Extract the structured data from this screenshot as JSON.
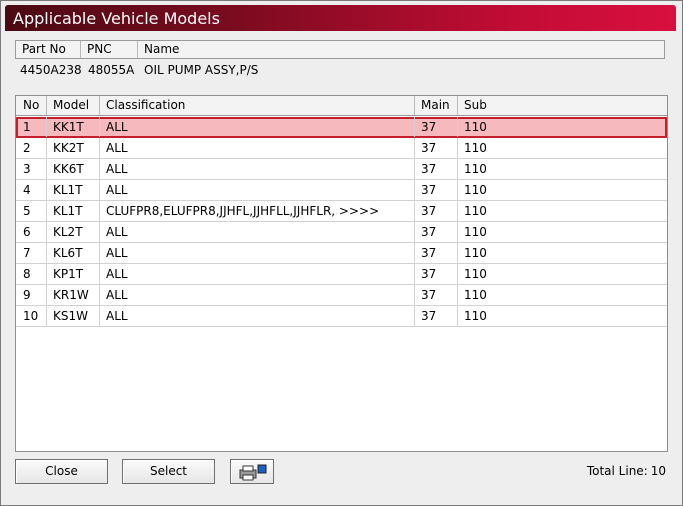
{
  "window": {
    "title": "Applicable Vehicle Models"
  },
  "part_info": {
    "headers": {
      "part_no": "Part No",
      "pnc": "PNC",
      "name": "Name"
    },
    "values": {
      "part_no": "4450A238",
      "pnc": "48055A",
      "name": "OIL PUMP ASSY,P/S"
    }
  },
  "grid": {
    "columns": {
      "no": "No",
      "model": "Model",
      "classification": "Classification",
      "main": "Main",
      "sub": "Sub"
    },
    "rows": [
      {
        "no": "1",
        "model": "KK1T",
        "classification": "ALL",
        "main": "37",
        "sub": "110"
      },
      {
        "no": "2",
        "model": "KK2T",
        "classification": "ALL",
        "main": "37",
        "sub": "110"
      },
      {
        "no": "3",
        "model": "KK6T",
        "classification": "ALL",
        "main": "37",
        "sub": "110"
      },
      {
        "no": "4",
        "model": "KL1T",
        "classification": "ALL",
        "main": "37",
        "sub": "110"
      },
      {
        "no": "5",
        "model": "KL1T",
        "classification": "CLUFPR8,ELUFPR8,JJHFL,JJHFLL,JJHFLR,  >>>>",
        "main": "37",
        "sub": "110"
      },
      {
        "no": "6",
        "model": "KL2T",
        "classification": "ALL",
        "main": "37",
        "sub": "110"
      },
      {
        "no": "7",
        "model": "KL6T",
        "classification": "ALL",
        "main": "37",
        "sub": "110"
      },
      {
        "no": "8",
        "model": "KP1T",
        "classification": "ALL",
        "main": "37",
        "sub": "110"
      },
      {
        "no": "9",
        "model": "KR1W",
        "classification": "ALL",
        "main": "37",
        "sub": "110"
      },
      {
        "no": "10",
        "model": "KS1W",
        "classification": "ALL",
        "main": "37",
        "sub": "110"
      }
    ],
    "selected_row": 0
  },
  "footer": {
    "close_label": "Close",
    "select_label": "Select",
    "print_icon": "printer-icon",
    "total_label": "Total Line:",
    "total_value": "10"
  }
}
